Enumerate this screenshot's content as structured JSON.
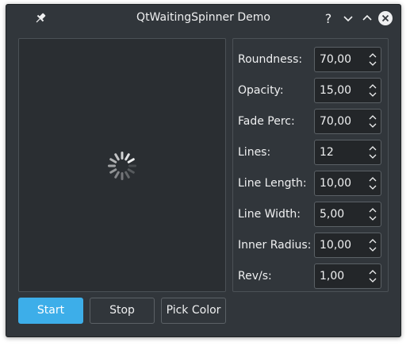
{
  "window": {
    "title": "QtWaitingSpinner Demo"
  },
  "titlebar": {
    "pin_icon": "pin-icon",
    "help_icon": "help-icon",
    "minimize_icon": "chevron-down-icon",
    "maximize_icon": "chevron-up-icon",
    "close_icon": "close-icon"
  },
  "settings": [
    {
      "label": "Roundness:",
      "value": "70,00"
    },
    {
      "label": "Opacity:",
      "value": "15,00"
    },
    {
      "label": "Fade Perc:",
      "value": "70,00"
    },
    {
      "label": "Lines:",
      "value": "12"
    },
    {
      "label": "Line Length:",
      "value": "10,00"
    },
    {
      "label": "Line Width:",
      "value": "5,00"
    },
    {
      "label": "Inner Radius:",
      "value": "10,00"
    },
    {
      "label": "Rev/s:",
      "value": "1,00"
    }
  ],
  "buttons": {
    "start": "Start",
    "stop": "Stop",
    "pick_color": "Pick Color"
  },
  "colors": {
    "accent": "#3daee9",
    "window_bg": "#31363b",
    "field_bg": "#232629"
  }
}
